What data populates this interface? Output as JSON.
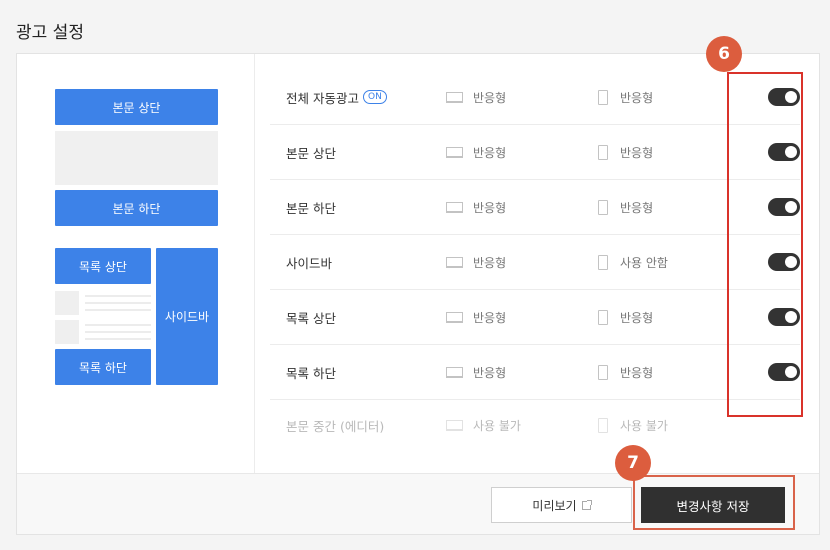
{
  "page_title": "광고 설정",
  "preview": {
    "top_label": "본문 상단",
    "bottom_label": "본문 하단",
    "list_top_label": "목록 상단",
    "list_bottom_label": "목록 하단",
    "sidebar_label": "사이드바"
  },
  "rows": [
    {
      "label": "전체 자동광고",
      "badge": "ON",
      "pc": "반응형",
      "mobile": "반응형",
      "toggle_on": true,
      "disabled": false
    },
    {
      "label": "본문 상단",
      "pc": "반응형",
      "mobile": "반응형",
      "toggle_on": true,
      "disabled": false
    },
    {
      "label": "본문 하단",
      "pc": "반응형",
      "mobile": "반응형",
      "toggle_on": true,
      "disabled": false
    },
    {
      "label": "사이드바",
      "pc": "반응형",
      "mobile": "사용 안함",
      "toggle_on": true,
      "disabled": false
    },
    {
      "label": "목록 상단",
      "pc": "반응형",
      "mobile": "반응형",
      "toggle_on": true,
      "disabled": false
    },
    {
      "label": "목록 하단",
      "pc": "반응형",
      "mobile": "반응형",
      "toggle_on": true,
      "disabled": false
    },
    {
      "label": "본문 중간 (에디터)",
      "pc": "사용 불가",
      "mobile": "사용 불가",
      "disabled": true
    }
  ],
  "buttons": {
    "preview_label": "미리보기",
    "save_label": "변경사항 저장"
  },
  "annotations": {
    "toggle_marker": "6",
    "save_marker": "7"
  },
  "colors": {
    "accent_blue": "#3d82e8",
    "annotation_red": "#d9322a",
    "badge_orange": "#dc5d3e",
    "toggle_dark": "#333333"
  }
}
